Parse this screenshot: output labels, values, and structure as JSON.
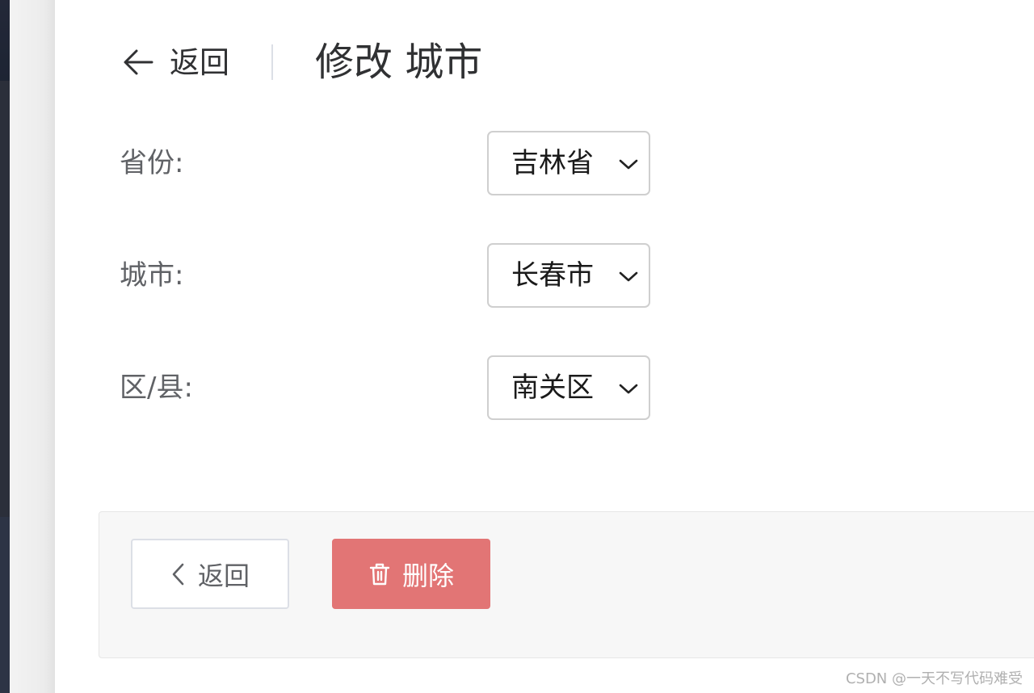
{
  "header": {
    "back_label": "返回",
    "title": "修改 城市"
  },
  "form": {
    "province": {
      "label": "省份:",
      "value": "吉林省"
    },
    "city": {
      "label": "城市:",
      "value": "长春市"
    },
    "district": {
      "label": "区/县:",
      "value": "南关区"
    }
  },
  "footer": {
    "back_button_label": "返回",
    "delete_button_label": "删除"
  },
  "watermark": "CSDN @一天不写代码难受",
  "colors": {
    "danger": "#e27575",
    "text_primary": "#303133",
    "text_secondary": "#606266",
    "border": "#dcdfe6"
  },
  "icons": {
    "header_back": "arrow-left-icon",
    "footer_back": "chevron-left-icon",
    "delete": "trash-icon",
    "select": "chevron-down-icon"
  }
}
